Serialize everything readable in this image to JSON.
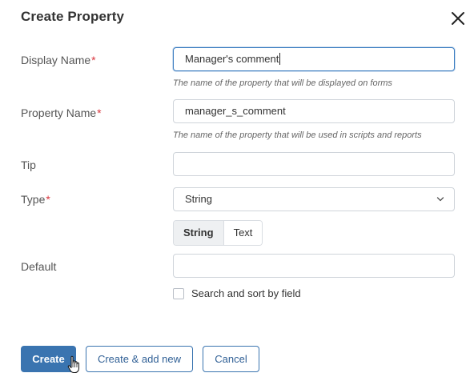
{
  "dialog": {
    "title": "Create Property",
    "close_icon": "close-icon"
  },
  "form": {
    "display_name": {
      "label": "Display Name",
      "required_mark": "*",
      "value": "Manager's comment",
      "hint": "The name of the property that will be displayed on forms"
    },
    "property_name": {
      "label": "Property Name",
      "required_mark": "*",
      "value": "manager_s_comment",
      "hint": "The name of the property that will be used in scripts and reports"
    },
    "tip": {
      "label": "Tip",
      "value": ""
    },
    "type": {
      "label": "Type",
      "required_mark": "*",
      "selected": "String",
      "arrow_icon": "chevron-down-icon"
    },
    "type_variant": {
      "options": [
        "String",
        "Text"
      ],
      "selected": "String"
    },
    "default": {
      "label": "Default",
      "value": ""
    },
    "search_sort": {
      "label": "Search and sort by field",
      "checked": false
    }
  },
  "actions": {
    "create": "Create",
    "create_add_new": "Create & add new",
    "cancel": "Cancel"
  },
  "colors": {
    "primary": "#3a74b0",
    "required": "#d9363e",
    "focus_border": "#3b7dc1"
  }
}
